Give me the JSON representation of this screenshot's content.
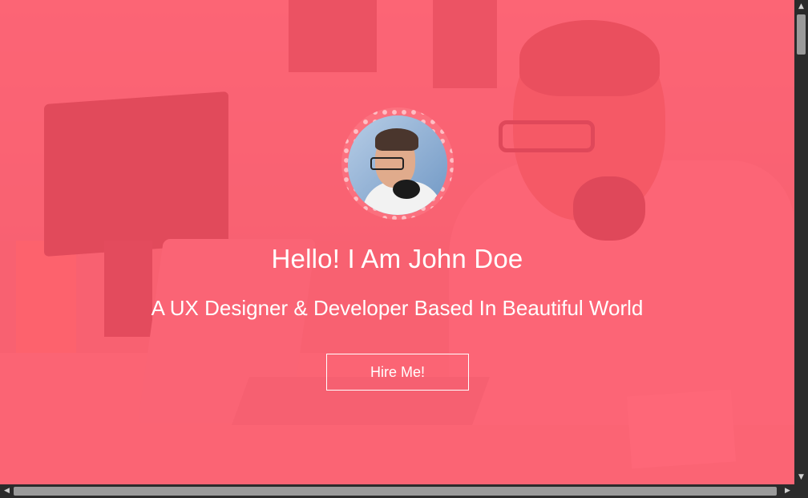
{
  "hero": {
    "title": "Hello! I Am John Doe",
    "subtitle": "A UX Designer & Developer Based In Beautiful World",
    "cta_label": "Hire Me!"
  },
  "colors": {
    "overlay": "#ff5064",
    "text": "#ffffff"
  },
  "icons": {
    "scroll_up": "▲",
    "scroll_down": "▼",
    "scroll_left": "◀",
    "scroll_right": "▶"
  }
}
